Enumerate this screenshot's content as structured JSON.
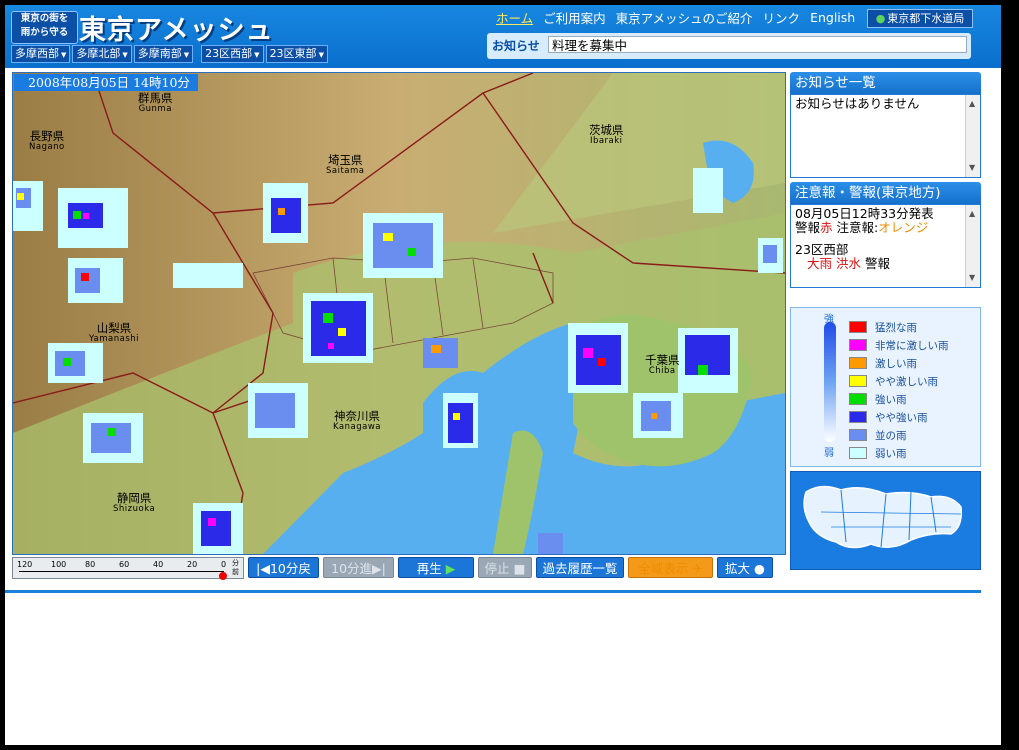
{
  "header": {
    "logo_line1": "東京の街を",
    "logo_line2": "雨から守る",
    "title": "東京アメッシュ",
    "area_tabs": [
      "多摩西部",
      "多摩北部",
      "多摩南部",
      "23区西部",
      "23区東部"
    ],
    "nav": [
      {
        "label": "ホーム",
        "active": true
      },
      {
        "label": "ご利用案内",
        "active": false
      },
      {
        "label": "東京アメッシュのご紹介",
        "active": false
      },
      {
        "label": "リンク",
        "active": false
      },
      {
        "label": "English",
        "active": false
      }
    ],
    "sewer_badge": "東京都下水道局",
    "notice_label": "お知らせ",
    "notice_text": "料理を募集中"
  },
  "map": {
    "timestamp": "2008年08月05日 14時10分",
    "prefectures": [
      {
        "ja": "群馬県",
        "en": "Gunma"
      },
      {
        "ja": "長野県",
        "en": "Nagano"
      },
      {
        "ja": "茨城県",
        "en": "Ibaraki"
      },
      {
        "ja": "埼玉県",
        "en": "Saitama"
      },
      {
        "ja": "山梨県",
        "en": "Yamanashi"
      },
      {
        "ja": "千葉県",
        "en": "Chiba"
      },
      {
        "ja": "神奈川県",
        "en": "Kanagawa"
      },
      {
        "ja": "静岡県",
        "en": "Shizuoka"
      }
    ]
  },
  "timeline": {
    "ticks": [
      "120",
      "100",
      "80",
      "60",
      "40",
      "20",
      "0"
    ],
    "unit_1": "分",
    "unit_2": "前"
  },
  "controls": {
    "back": "10分戻",
    "forward": "10分進",
    "play": "再生",
    "stop": "停止",
    "history": "過去履歴一覧",
    "full_view": "全域表示",
    "zoom": "拡大"
  },
  "notices_panel": {
    "title": "お知らせ一覧",
    "body": "お知らせはありません"
  },
  "warnings_panel": {
    "title": "注意報・警報(東京地方)",
    "issued": "08月05日12時33分発表",
    "legend_warning": "警報",
    "legend_warning_color": "赤",
    "legend_advisory": "注意報",
    "legend_advisory_color": "オレンジ",
    "area": "23区西部",
    "item1": "大雨",
    "item2": "洪水",
    "item_suffix": "警報"
  },
  "legend": {
    "strong": "強",
    "weak": "弱",
    "items": [
      {
        "label": "猛烈な雨",
        "color": "#ff0000"
      },
      {
        "label": "非常に激しい雨",
        "color": "#ff00ff"
      },
      {
        "label": "激しい雨",
        "color": "#ff9900"
      },
      {
        "label": "やや激しい雨",
        "color": "#ffff00"
      },
      {
        "label": "強い雨",
        "color": "#00dd00"
      },
      {
        "label": "やや強い雨",
        "color": "#2a2ae8"
      },
      {
        "label": "並の雨",
        "color": "#6a8ef0"
      },
      {
        "label": "弱い雨",
        "color": "#ccffff"
      }
    ]
  },
  "colors": {
    "accent": "#1a7be0",
    "header": "#0a6fcd",
    "sea": "#58aff0",
    "land": "#c2a36e"
  }
}
